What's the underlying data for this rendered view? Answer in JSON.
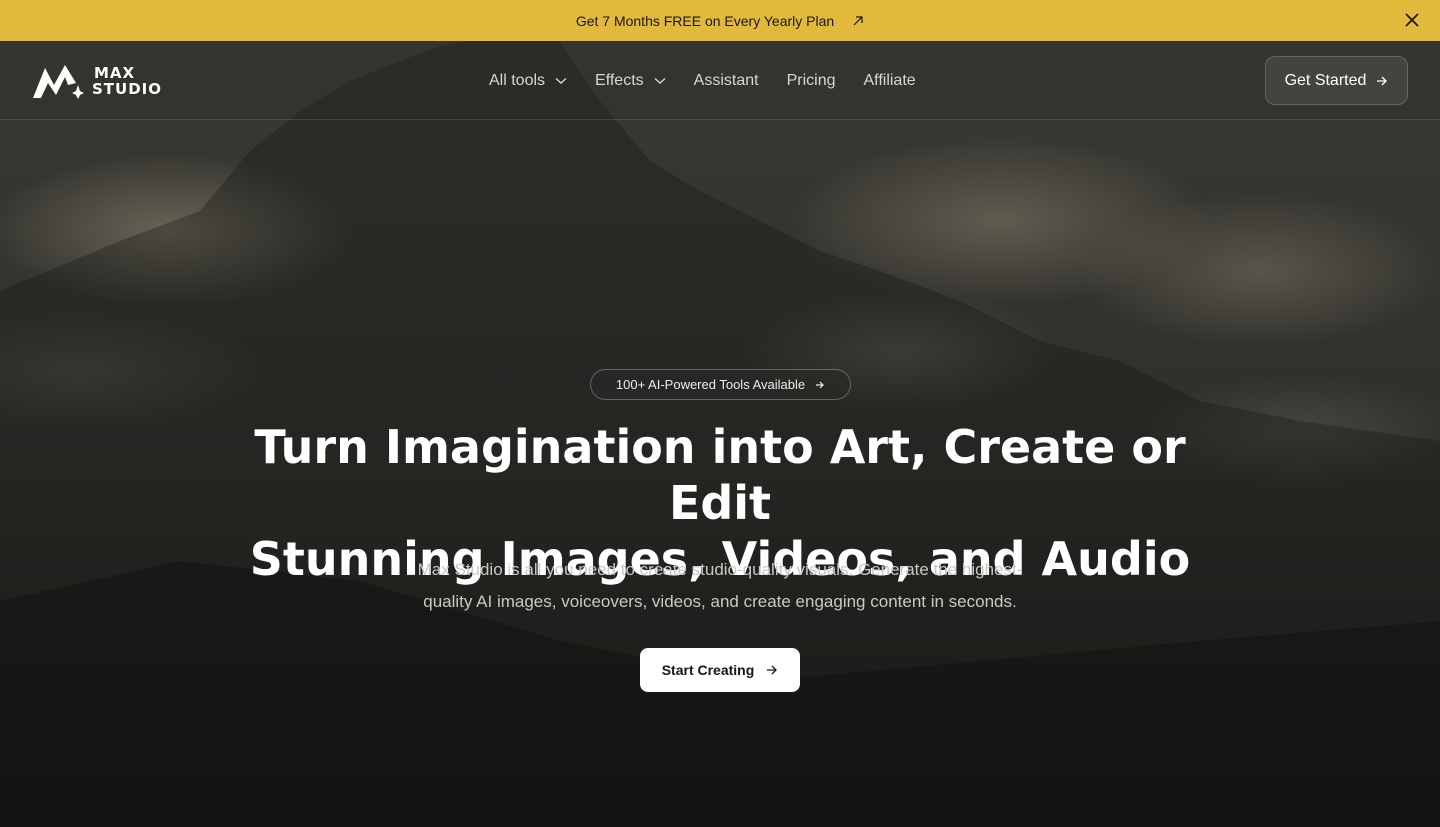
{
  "promo": {
    "text": "Get 7 Months FREE on Every Yearly Plan",
    "link_icon": "arrow-up-right-icon",
    "close_icon": "close-icon",
    "background": "#e2b93b"
  },
  "nav": {
    "logo_line1": "MAX",
    "logo_line2": "STUDIO",
    "items": [
      {
        "label": "All tools",
        "has_dropdown": true
      },
      {
        "label": "Effects",
        "has_dropdown": true
      },
      {
        "label": "Assistant",
        "has_dropdown": false
      },
      {
        "label": "Pricing",
        "has_dropdown": false
      },
      {
        "label": "Affiliate",
        "has_dropdown": false
      }
    ],
    "cta_label": "Get Started"
  },
  "hero": {
    "badge": "100+ AI-Powered Tools Available",
    "headline_line1": "Turn Imagination into Art, Create or Edit",
    "headline_line2": "Stunning Images, Videos, and Audio",
    "subtext_line1": "Max Studio is all you need to create studio-quality visuals. Generate the highest-",
    "subtext_line2": "quality AI images, voiceovers, videos, and create engaging content in seconds.",
    "cta_label": "Start Creating"
  }
}
